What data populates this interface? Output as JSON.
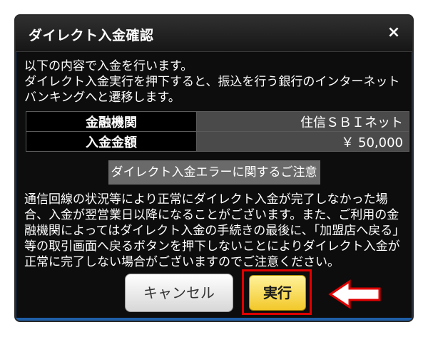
{
  "dialog": {
    "title": "ダイレクト入金確認",
    "close_icon": "×"
  },
  "intro": {
    "text": "以下の内容で入金を行います。\nダイレクト入金実行を押下すると、振込を行う銀行のインターネットバンキングへと遷移します。"
  },
  "details": {
    "rows": [
      {
        "label": "金融機関",
        "value": "住信ＳＢＩネット"
      },
      {
        "label": "入金金額",
        "value": "￥ 50,000"
      }
    ]
  },
  "notice": {
    "title": "ダイレクト入金エラーに関するご注意",
    "body": "通信回線の状況等により正常にダイレクト入金が完了しなかった場合、入金が翌営業日以降になることがございます。また、ご利用の金融機関によってはダイレクト入金の手続きの最後に、「加盟店へ戻る」等の取引画面へ戻るボタンを押下しないことによりダイレクト入金が正常に完了しない場合がございますのでご注意ください。"
  },
  "buttons": {
    "cancel_label": "キャンセル",
    "execute_label": "実行"
  },
  "annotation": {
    "highlight_color": "#e00000",
    "arrow_icon": "left-arrow-outline-icon"
  }
}
